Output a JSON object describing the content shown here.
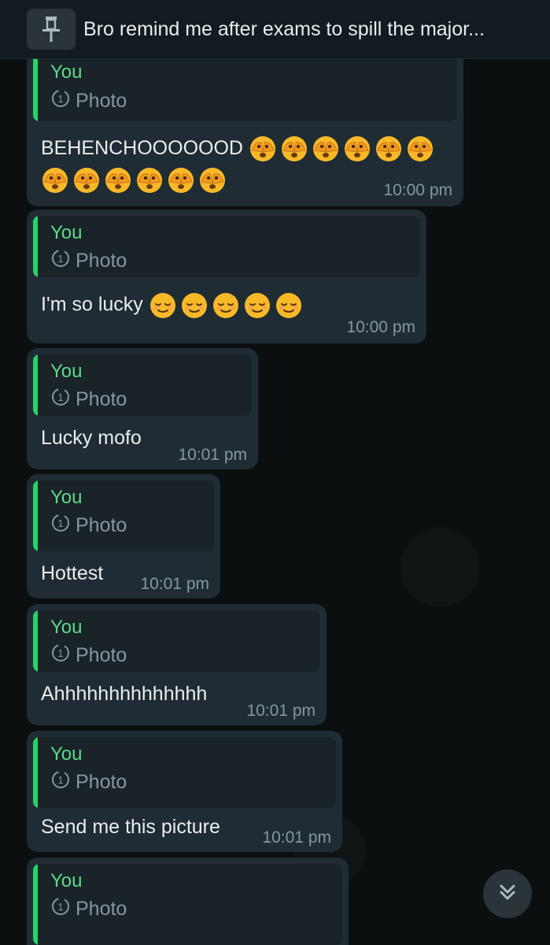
{
  "pinned": {
    "text": "Bro remind me after exams to spill the major..."
  },
  "messages": [
    {
      "author": "You",
      "type": "Photo",
      "text": "BEHENCHOOOOOOD",
      "time": "10:00 pm",
      "emoji": "face-with-peeking-eye",
      "emoji_count": 12
    },
    {
      "author": "You",
      "type": "Photo",
      "text": "I'm so lucky",
      "time": "10:00 pm",
      "emoji": "relieved-face",
      "emoji_count": 5
    },
    {
      "author": "You",
      "type": "Photo",
      "text": "Lucky mofo",
      "time": "10:01 pm"
    },
    {
      "author": "You",
      "type": "Photo",
      "text": "Hottest",
      "time": "10:01 pm"
    },
    {
      "author": "You",
      "type": "Photo",
      "text": "Ahhhhhhhhhhhhhh",
      "time": "10:01 pm"
    },
    {
      "author": "You",
      "type": "Photo",
      "text": "Send me this picture",
      "time": "10:01 pm"
    },
    {
      "author": "You",
      "type": "Photo"
    }
  ],
  "icons": {
    "pin": "pin-icon",
    "view_once": "view-once-icon",
    "scroll": "double-chevron-down-icon"
  },
  "colors": {
    "quote_bar": "#25d366",
    "author": "#5dd98a",
    "bubble": "#202c33"
  }
}
